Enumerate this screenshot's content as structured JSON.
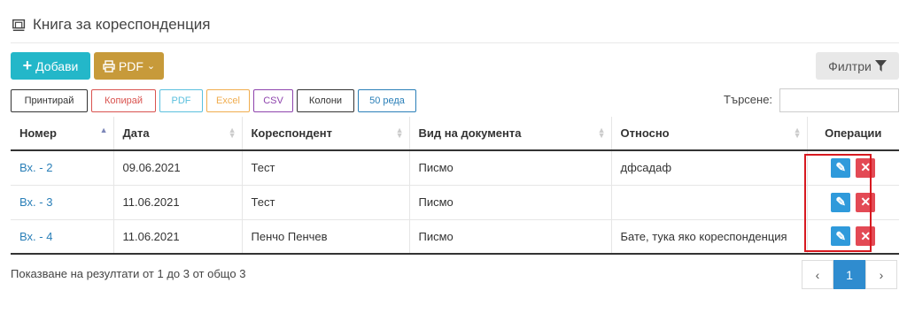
{
  "page": {
    "title": "Книга за кореспонденция"
  },
  "toolbar": {
    "add_label": "Добави",
    "pdf_label": "PDF",
    "filter_label": "Филтри"
  },
  "export_buttons": [
    {
      "label": "Принтирай",
      "color": "#333333"
    },
    {
      "label": "Копирай",
      "color": "#d9534f"
    },
    {
      "label": "PDF",
      "color": "#5bc0de"
    },
    {
      "label": "Excel",
      "color": "#f0ad4e"
    },
    {
      "label": "CSV",
      "color": "#8e44ad"
    },
    {
      "label": "Колони",
      "color": "#333333"
    },
    {
      "label": "50 реда",
      "color": "#2a7fb8"
    }
  ],
  "search": {
    "label": "Търсене:",
    "value": ""
  },
  "table": {
    "headers": [
      "Номер",
      "Дата",
      "Кореспондент",
      "Вид на документа",
      "Относно",
      "Операции"
    ],
    "rows": [
      {
        "number": "Вх. - 2",
        "date": "09.06.2021",
        "correspondent": "Тест",
        "type": "Писмо",
        "subject": "дфсадаф"
      },
      {
        "number": "Вх. - 3",
        "date": "11.06.2021",
        "correspondent": "Тест",
        "type": "Писмо",
        "subject": ""
      },
      {
        "number": "Вх. - 4",
        "date": "11.06.2021",
        "correspondent": "Пенчо Пенчев",
        "type": "Писмо",
        "subject": "Бате, тука яко кореспонденция"
      }
    ]
  },
  "footer": {
    "summary": "Показване на резултати от 1 до 3 от общо 3"
  },
  "pagination": {
    "prev": "‹",
    "current": "1",
    "next": "›"
  },
  "colors": {
    "add_button": "#23b7c9",
    "pdf_button": "#c79a3a",
    "edit_button": "#2f9adb",
    "delete_button": "#e34a55",
    "highlight_box": "#d71920"
  },
  "icons": {
    "title": "book-icon",
    "add": "plus-icon",
    "pdf": "printer-icon",
    "filter": "funnel-icon",
    "edit": "edit-icon",
    "delete": "close-icon"
  }
}
